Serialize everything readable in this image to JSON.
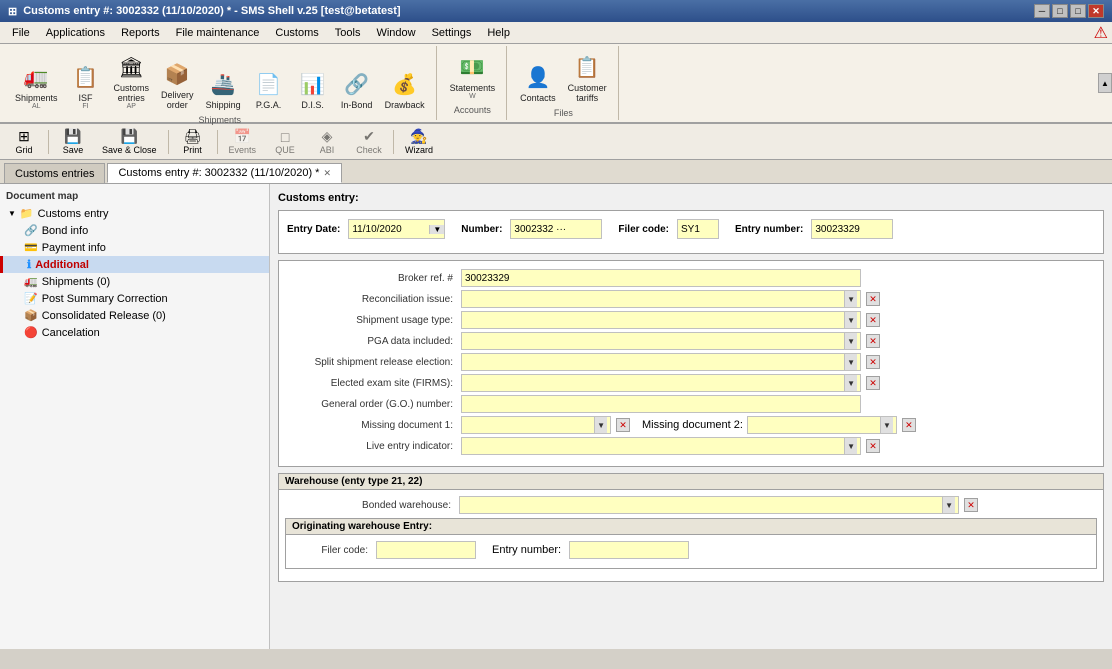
{
  "titlebar": {
    "title": "Customs entry #: 3002332 (11/10/2020) * - SMS Shell v.25 [test@betatest]",
    "icon": "⊞"
  },
  "menubar": {
    "items": [
      {
        "id": "file",
        "label": "File"
      },
      {
        "id": "applications",
        "label": "Applications"
      },
      {
        "id": "reports",
        "label": "Reports"
      },
      {
        "id": "file-maintenance",
        "label": "File maintenance"
      },
      {
        "id": "customs",
        "label": "Customs"
      },
      {
        "id": "tools",
        "label": "Tools"
      },
      {
        "id": "window",
        "label": "Window"
      },
      {
        "id": "settings",
        "label": "Settings"
      },
      {
        "id": "help",
        "label": "Help"
      }
    ]
  },
  "ribbon": {
    "groups": [
      {
        "id": "shipments-group",
        "label": "Shipments",
        "items": [
          {
            "id": "shipments",
            "icon": "🚛",
            "label": "Shipments",
            "shortcut": "AL"
          },
          {
            "id": "isf",
            "icon": "📋",
            "label": "ISF",
            "shortcut": "FI"
          },
          {
            "id": "customs-entries",
            "icon": "🏛",
            "label": "Customs\nentries",
            "shortcut": "AP"
          },
          {
            "id": "delivery-order",
            "icon": "📦",
            "label": "Delivery\norder"
          },
          {
            "id": "shipping",
            "icon": "🚢",
            "label": "Shipping"
          },
          {
            "id": "pga",
            "icon": "📄",
            "label": "P.G.A."
          },
          {
            "id": "dis",
            "icon": "📊",
            "label": "D.I.S."
          },
          {
            "id": "in-bond",
            "icon": "🔗",
            "label": "In-Bond"
          },
          {
            "id": "drawback",
            "icon": "💰",
            "label": "Drawback"
          }
        ]
      },
      {
        "id": "accounts-group",
        "label": "Accounts",
        "items": [
          {
            "id": "statements",
            "icon": "💵",
            "label": "Statements",
            "shortcut": "W"
          }
        ]
      },
      {
        "id": "files-group",
        "label": "Files",
        "items": [
          {
            "id": "contacts",
            "icon": "👤",
            "label": "Contacts"
          },
          {
            "id": "customer-tariffs",
            "icon": "📋",
            "label": "Customer\ntariffs"
          }
        ]
      }
    ]
  },
  "toolbar": {
    "buttons": [
      {
        "id": "grid",
        "icon": "⊞",
        "label": "Grid",
        "enabled": true
      },
      {
        "id": "save",
        "icon": "💾",
        "label": "Save",
        "enabled": true
      },
      {
        "id": "save-close",
        "icon": "💾",
        "label": "Save & Close",
        "enabled": true
      },
      {
        "id": "print",
        "icon": "🖨",
        "label": "Print",
        "enabled": true
      },
      {
        "id": "events",
        "icon": "📅",
        "label": "Events",
        "enabled": false
      },
      {
        "id": "que",
        "icon": "□",
        "label": "QUE",
        "enabled": false
      },
      {
        "id": "abi",
        "icon": "◈",
        "label": "ABI",
        "enabled": false
      },
      {
        "id": "check",
        "icon": "✔",
        "label": "Check",
        "enabled": false
      },
      {
        "id": "wizard",
        "icon": "🧙",
        "label": "Wizard",
        "enabled": true
      }
    ]
  },
  "tabs": [
    {
      "id": "customs-entries-tab",
      "label": "Customs entries",
      "closeable": false,
      "active": false
    },
    {
      "id": "customs-entry-tab",
      "label": "Customs entry #: 3002332 (11/10/2020) *",
      "closeable": true,
      "active": true
    }
  ],
  "tree": {
    "header": "Document map",
    "items": [
      {
        "id": "customs-entry-root",
        "label": "Customs entry",
        "level": 0,
        "expanded": true,
        "icon": "📁",
        "type": "folder"
      },
      {
        "id": "bond-info",
        "label": "Bond info",
        "level": 1,
        "icon": "🔗",
        "type": "item"
      },
      {
        "id": "payment-info",
        "label": "Payment info",
        "level": 1,
        "icon": "💳",
        "type": "item"
      },
      {
        "id": "additional",
        "label": "Additional",
        "level": 1,
        "icon": "ℹ",
        "type": "item",
        "active": true
      },
      {
        "id": "shipments-0",
        "label": "Shipments (0)",
        "level": 1,
        "icon": "🚛",
        "type": "item"
      },
      {
        "id": "post-summary",
        "label": "Post Summary Correction",
        "level": 1,
        "icon": "📝",
        "type": "item"
      },
      {
        "id": "consolidated-release",
        "label": "Consolidated Release (0)",
        "level": 1,
        "icon": "📦",
        "type": "item"
      },
      {
        "id": "cancelation",
        "label": "Cancelation",
        "level": 1,
        "icon": "🔴",
        "type": "item"
      }
    ]
  },
  "content": {
    "section_title": "Customs entry:",
    "entry_date_label": "Entry Date:",
    "entry_date_value": "11/10/2020",
    "number_label": "Number:",
    "number_value": "3002332 ···",
    "filer_code_label": "Filer code:",
    "filer_code_value": "SY1",
    "entry_number_label": "Entry number:",
    "entry_number_value": "30023329",
    "fields": [
      {
        "id": "broker-ref",
        "label": "Broker ref. #",
        "value": "30023329",
        "type": "text",
        "clearable": false
      },
      {
        "id": "reconciliation-issue",
        "label": "Reconciliation issue:",
        "value": "",
        "type": "dropdown",
        "clearable": true
      },
      {
        "id": "shipment-usage-type",
        "label": "Shipment usage type:",
        "value": "",
        "type": "dropdown",
        "clearable": true
      },
      {
        "id": "pga-data-included",
        "label": "PGA data included:",
        "value": "",
        "type": "dropdown",
        "clearable": true
      },
      {
        "id": "split-shipment",
        "label": "Split shipment release election:",
        "value": "",
        "type": "dropdown",
        "clearable": true
      },
      {
        "id": "elected-exam-site",
        "label": "Elected exam site (FIRMS):",
        "value": "",
        "type": "dropdown",
        "clearable": true
      },
      {
        "id": "general-order",
        "label": "General order (G.O.) number:",
        "value": "",
        "type": "text",
        "clearable": false
      },
      {
        "id": "missing-doc-1",
        "label": "Missing document 1:",
        "value": "",
        "type": "dropdown-half",
        "clearable": true
      },
      {
        "id": "missing-doc-2",
        "label": "Missing document 2:",
        "value": "",
        "type": "dropdown-half",
        "clearable": true
      },
      {
        "id": "live-entry-indicator",
        "label": "Live entry indicator:",
        "value": "",
        "type": "dropdown",
        "clearable": true
      }
    ],
    "warehouse_section": {
      "title": "Warehouse (enty type 21, 22)",
      "bonded_warehouse_label": "Bonded warehouse:",
      "bonded_warehouse_value": "",
      "originating_section": {
        "title": "Originating warehouse Entry:",
        "filer_code_label": "Filer code:",
        "filer_code_value": "",
        "entry_number_label": "Entry number:",
        "entry_number_value": ""
      }
    }
  }
}
